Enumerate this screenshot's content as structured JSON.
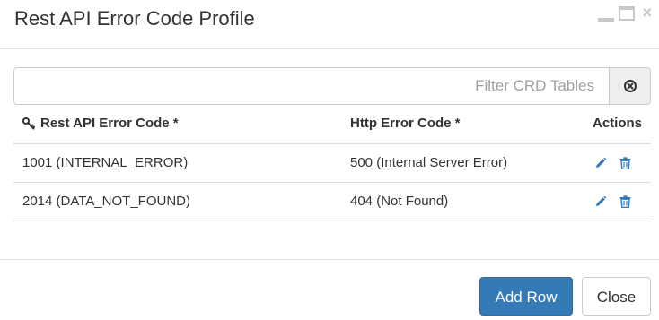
{
  "dialog": {
    "title": "Rest API Error Code Profile",
    "window_controls": [
      "minimize-icon",
      "maximize-icon",
      "close-icon"
    ],
    "close_glyph": "×"
  },
  "filter": {
    "placeholder": "Filter CRD Tables",
    "value": "",
    "clear_icon": "circle-x-icon"
  },
  "table": {
    "key_icon": "key-icon",
    "headers": {
      "code": "Rest API Error Code *",
      "http": "Http Error Code *",
      "actions": "Actions"
    },
    "rows": [
      {
        "code": "1001 (INTERNAL_ERROR)",
        "http": "500 (Internal Server Error)",
        "edit_icon": "pencil-icon",
        "delete_icon": "trash-icon"
      },
      {
        "code": "2014 (DATA_NOT_FOUND)",
        "http": "404 (Not Found)",
        "edit_icon": "pencil-icon",
        "delete_icon": "trash-icon"
      }
    ]
  },
  "footer": {
    "add_row_label": "Add Row",
    "close_label": "Close"
  },
  "colors": {
    "primary": "#337ab7",
    "action_icon": "#337ab7",
    "window_controls": "#c8c8c8"
  }
}
